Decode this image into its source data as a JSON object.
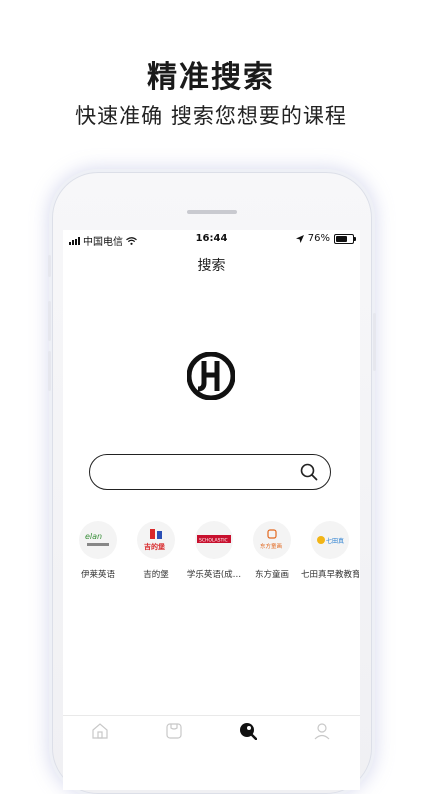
{
  "promo": {
    "headline": "精准搜索",
    "subline": "快速准确  搜索您想要的课程"
  },
  "status_bar": {
    "carrier": "中国电信",
    "time": "16:44",
    "battery": "76%",
    "battery_level": 0.76
  },
  "nav": {
    "title": "搜索"
  },
  "brand": {
    "logo_icon": "jh-monogram-logo"
  },
  "search": {
    "placeholder": "",
    "icon": "search-icon"
  },
  "institutions": [
    {
      "name": "伊莱英语",
      "logo_text": "elan",
      "accent": "#3a8f3a"
    },
    {
      "name": "吉的堡",
      "logo_text": "吉的堡",
      "accent": "#d8282a"
    },
    {
      "name": "学乐英语(成…",
      "logo_text": "SCHOLASTIC",
      "accent": "#c8102e"
    },
    {
      "name": "东方童画",
      "logo_text": "东方童画",
      "accent": "#e2681f"
    },
    {
      "name": "七田真早教教育",
      "logo_text": "七田真",
      "accent": "#f2b517"
    }
  ],
  "tabbar": {
    "items": [
      {
        "icon": "home-icon",
        "active": false
      },
      {
        "icon": "book-icon",
        "active": false
      },
      {
        "icon": "search-icon",
        "active": true
      },
      {
        "icon": "user-icon",
        "active": false
      }
    ]
  }
}
